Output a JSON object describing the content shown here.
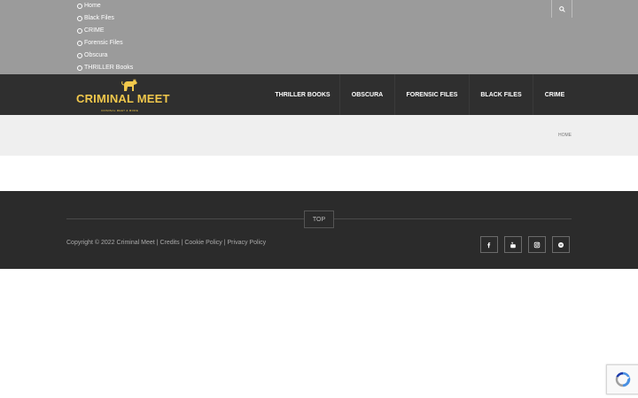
{
  "top_menu": {
    "items": [
      "Home",
      "Black Files",
      "CRIME",
      "Forensic Files",
      "Obscura",
      "THRILLER Books"
    ]
  },
  "search": {
    "icon": "search-icon"
  },
  "logo": {
    "text": "CRIMINAL MEET",
    "subtext": "CRIMINAL MEET & MORE"
  },
  "main_nav": {
    "items": [
      "THRILLER BOOKS",
      "OBSCURA",
      "FORENSIC FILES",
      "BLACK FILES",
      "CRIME"
    ]
  },
  "breadcrumb": {
    "home": "HOME"
  },
  "footer": {
    "top_label": "TOP",
    "copyright": "Copyright © 2022 Criminal Meet",
    "sep": "|",
    "links": [
      "Credits",
      "Cookie Policy",
      "Privacy Policy"
    ],
    "social_icons": [
      "facebook-icon",
      "youtube-icon",
      "instagram-icon",
      "spotify-icon"
    ]
  },
  "colors": {
    "top_bg": "#9b9b9b",
    "header_bg": "#2f2f2f",
    "logo_yellow": "#f1c84c",
    "band_bg": "#efefef",
    "footer_bg": "#2b2b2b"
  }
}
